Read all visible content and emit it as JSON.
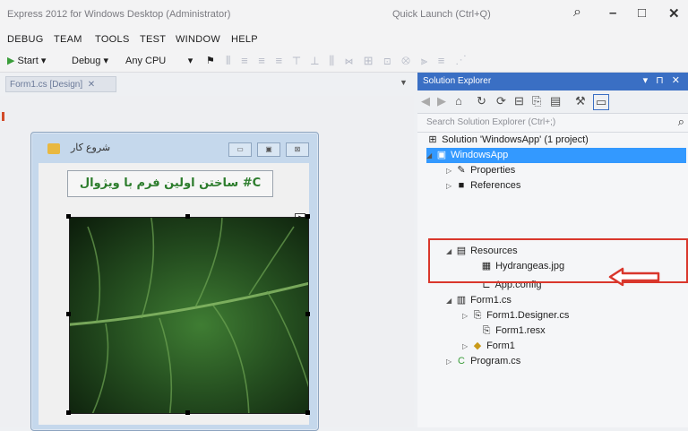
{
  "window": {
    "title": "Express 2012 for Windows Desktop (Administrator)",
    "quick_launch_placeholder": "Quick Launch (Ctrl+Q)"
  },
  "menu": [
    "DEBUG",
    "TEAM",
    "TOOLS",
    "TEST",
    "WINDOW",
    "HELP"
  ],
  "toolbar": {
    "start_label": "Start",
    "config_value": "Debug",
    "platform_value": "Any CPU"
  },
  "designer": {
    "tab_label": "Form1.cs [Design]",
    "form_caption": "شروع کار",
    "form_label_text": "ساختن اولین فرم با ویژوال #C"
  },
  "solution_explorer": {
    "title": "Solution Explorer",
    "search_placeholder": "Search Solution Explorer (Ctrl+;)",
    "solution": "Solution 'WindowsApp' (1 project)",
    "project": "WindowsApp",
    "nodes": {
      "properties": "Properties",
      "references": "References",
      "resources": "Resources",
      "hydrangeas": "Hydrangeas.jpg",
      "app_config": "App.config",
      "form1_cs": "Form1.cs",
      "form1_designer": "Form1.Designer.cs",
      "form1_resx": "Form1.resx",
      "form1": "Form1",
      "program": "Program.cs"
    }
  },
  "colors": {
    "accent": "#3a6fc4",
    "selection": "#3399ff",
    "highlight": "#d9372c",
    "label_text": "#2d7d2d"
  }
}
